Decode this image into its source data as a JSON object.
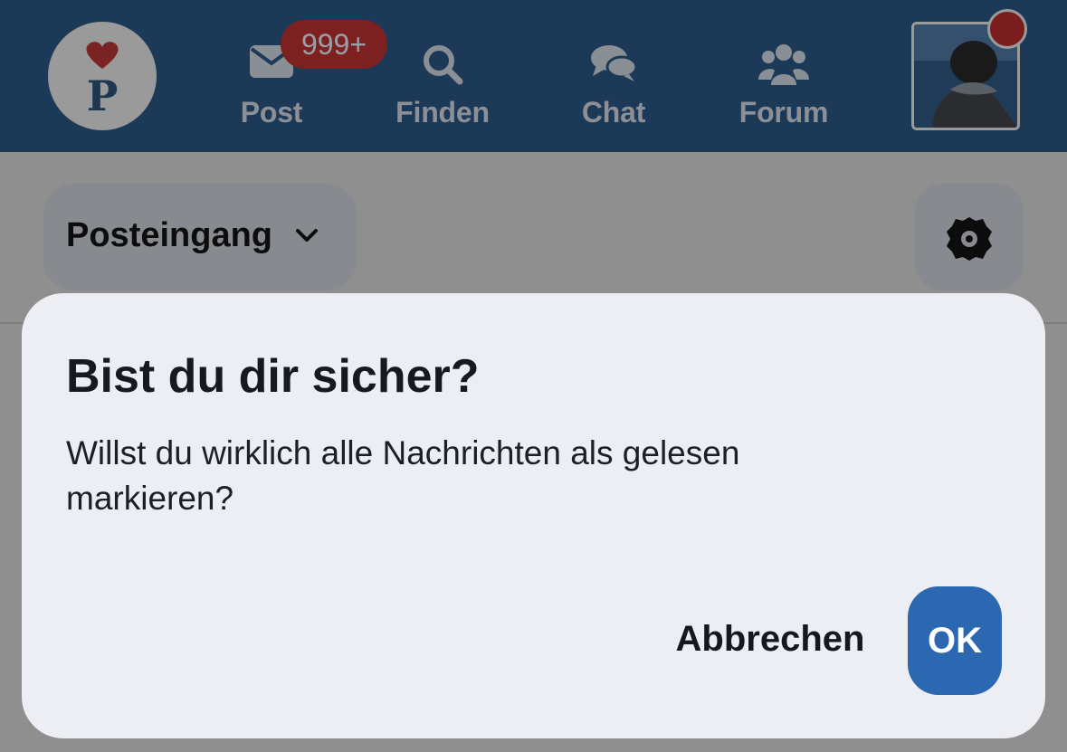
{
  "app": {
    "logo_letter": "P"
  },
  "nav": {
    "items": [
      {
        "label": "Post",
        "icon": "mail-icon"
      },
      {
        "label": "Finden",
        "icon": "search-icon"
      },
      {
        "label": "Chat",
        "icon": "chat-bubbles-icon"
      },
      {
        "label": "Forum",
        "icon": "users-group-icon"
      }
    ],
    "post_badge": "999+"
  },
  "toolbar": {
    "folder_label": "Posteingang",
    "folder_icon": "chevron-down-icon",
    "settings_icon": "gear-icon"
  },
  "dialog": {
    "title": "Bist du dir sicher?",
    "message": "Willst du wirklich alle Nachrichten als gelesen markieren?",
    "cancel_label": "Abbrechen",
    "ok_label": "OK"
  },
  "colors": {
    "topbar": "#1c3a58",
    "primary_button": "#2c67b1",
    "badge": "#7c2020",
    "dialog_bg": "#eceef4"
  }
}
